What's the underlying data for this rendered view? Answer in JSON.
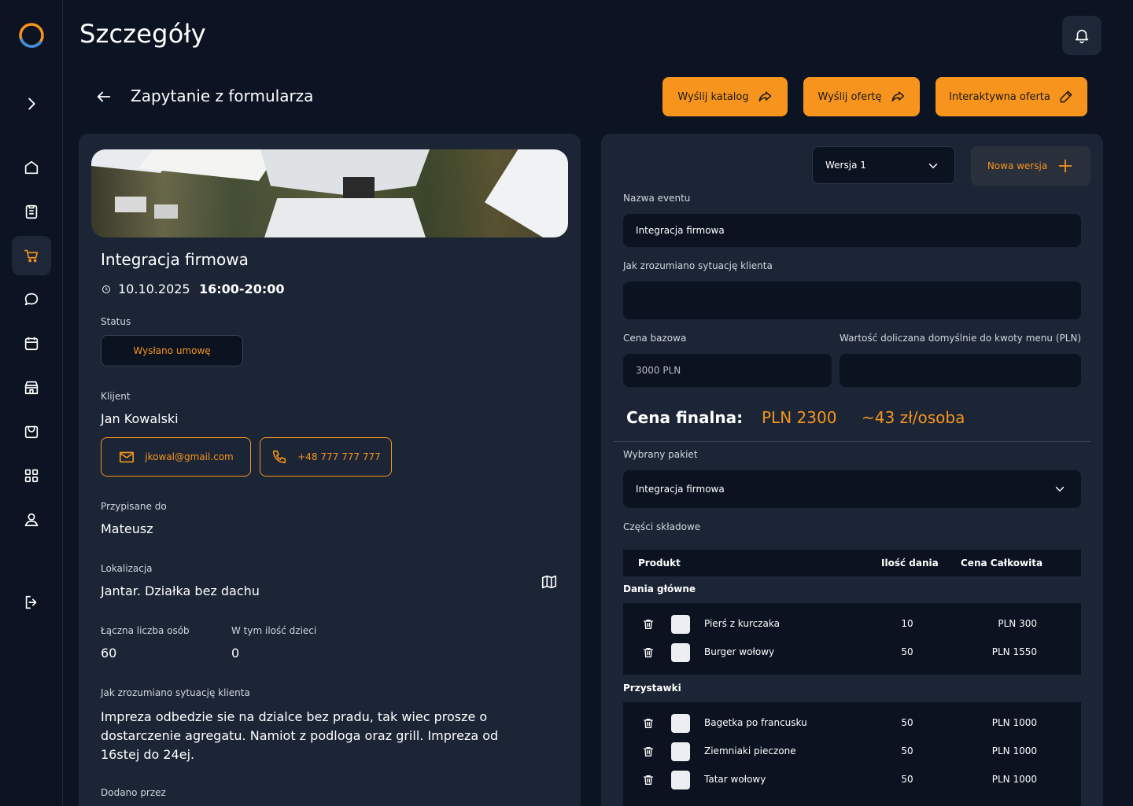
{
  "page": {
    "title": "Szczegóły",
    "subtitle": "Zapytanie z formularza"
  },
  "colors": {
    "accent": "#f7941d",
    "background": "#0c1423",
    "panel": "#1b2535",
    "field": "#0b1220"
  },
  "sidebar": {
    "items": [
      {
        "icon": "chevron-right-icon"
      },
      {
        "icon": "home-icon"
      },
      {
        "icon": "clipboard-icon"
      },
      {
        "icon": "cart-icon",
        "active": true
      },
      {
        "icon": "chat-icon"
      },
      {
        "icon": "calendar-icon"
      },
      {
        "icon": "store-icon"
      },
      {
        "icon": "bag-icon"
      },
      {
        "icon": "grid-icon"
      },
      {
        "icon": "user-icon"
      },
      {
        "icon": "logout-icon"
      }
    ]
  },
  "actions": {
    "send_catalog": "Wyślij katalog",
    "send_offer": "Wyślij ofertę",
    "interactive_offer": "Interaktywna oferta"
  },
  "event": {
    "name": "Integracja firmowa",
    "date": "10.10.2025",
    "time": "16:00-20:00",
    "status_label": "Status",
    "status": "Wysłano umowę",
    "client_label": "Klijent",
    "client": "Jan Kowalski",
    "email": "jkowal@gmail.com",
    "phone": "+48 777 777 777",
    "assigned_label": "Przypisane do",
    "assigned": "Mateusz",
    "location_label": "Lokalizacja",
    "location": "Jantar. Działka bez dachu",
    "people_label": "Łączna liczba osób",
    "people": "60",
    "children_label": "W tym ilość dzieci",
    "children": "0",
    "situation_label": "Jak zrozumiano sytuację klienta",
    "situation": "Impreza odbedzie sie na dzialce bez pradu, tak wiec prosze o dostarczenie agregatu. Namiot z podloga oraz grill. Impreza od 16stej do 24ej.",
    "added_by_label": "Dodano przez"
  },
  "offer": {
    "version": "Wersja 1",
    "new_version": "Nowa wersja",
    "event_name_label": "Nazwa eventu",
    "event_name": "Integracja firmowa",
    "situation_label": "Jak zrozumiano sytuację klienta",
    "situation": "",
    "base_price_label": "Cena bazowa",
    "base_price": "3000 PLN",
    "default_value_label": "Wartość doliczana domyślnie do kwoty menu (PLN)",
    "default_value": "",
    "final_label": "Cena finalna:",
    "final_price": "PLN 2300",
    "per_person": "~43 zł/osoba",
    "package_label": "Wybrany pakiet",
    "package": "Integracja firmowa",
    "components_label": "Części składowe",
    "columns": [
      "Produkt",
      "Ilość dania",
      "Cena Całkowita"
    ],
    "groups": [
      {
        "title": "Dania główne",
        "rows": [
          {
            "name": "Pierś z kurczaka",
            "qty": "10",
            "price": "PLN 300"
          },
          {
            "name": "Burger wołowy",
            "qty": "50",
            "price": "PLN 1550"
          }
        ]
      },
      {
        "title": "Przystawki",
        "rows": [
          {
            "name": "Bagetka po francusku",
            "qty": "50",
            "price": "PLN 1000"
          },
          {
            "name": "Ziemniaki pieczone",
            "qty": "50",
            "price": "PLN 1000"
          },
          {
            "name": "Tatar wołowy",
            "qty": "50",
            "price": "PLN 1000"
          }
        ]
      }
    ]
  }
}
